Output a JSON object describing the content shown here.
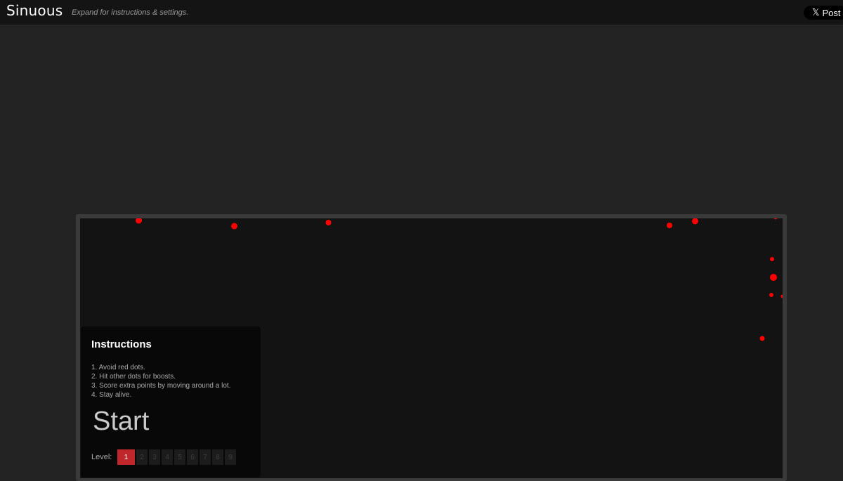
{
  "header": {
    "logo": "Sinuous",
    "tagline": "Expand for instructions & settings.",
    "post_button": {
      "icon": "x-logo-icon",
      "label": "Post"
    }
  },
  "game": {
    "dot_color": "#ff0000",
    "instructions": {
      "title": "Instructions",
      "items": [
        "1. Avoid red dots.",
        "2. Hit other dots for boosts.",
        "3. Score extra points by moving around a lot.",
        "4. Stay alive."
      ]
    },
    "start_label": "Start",
    "level_label": "Level:",
    "levels": [
      "1",
      "2",
      "3",
      "4",
      "5",
      "6",
      "7",
      "8",
      "9"
    ],
    "selected_level": "1",
    "accent_color": "#c0272d"
  }
}
